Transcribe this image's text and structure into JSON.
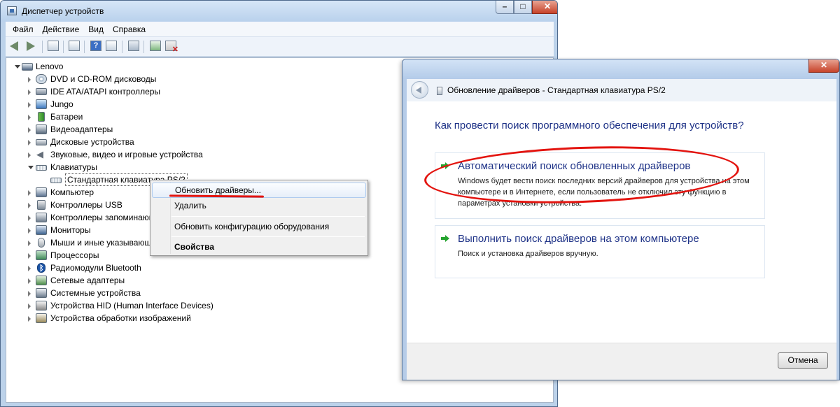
{
  "device_manager": {
    "title": "Диспетчер устройств",
    "menu": [
      "Файл",
      "Действие",
      "Вид",
      "Справка"
    ],
    "tree_root": "Lenovo",
    "tree_items": [
      {
        "label": "DVD и CD-ROM дисководы",
        "icon": "dvd-drive-icon"
      },
      {
        "label": "IDE ATA/ATAPI контроллеры",
        "icon": "ide-controller-icon"
      },
      {
        "label": "Jungo",
        "icon": "jungo-device-icon"
      },
      {
        "label": "Батареи",
        "icon": "battery-icon"
      },
      {
        "label": "Видеоадаптеры",
        "icon": "video-adapter-icon"
      },
      {
        "label": "Дисковые устройства",
        "icon": "disk-drive-icon"
      },
      {
        "label": "Звуковые, видео и игровые устройства",
        "icon": "speaker-icon"
      },
      {
        "label": "Клавиатуры",
        "icon": "keyboard-icon"
      },
      {
        "label": "Стандартная клавиатура PS/2",
        "icon": "keyboard-icon"
      },
      {
        "label": "Компьютер",
        "icon": "computer-icon"
      },
      {
        "label": "Контроллеры USB",
        "icon": "usb-icon"
      },
      {
        "label": "Контроллеры запоминающих устройств",
        "icon": "storage-controller-icon"
      },
      {
        "label": "Мониторы",
        "icon": "monitor-icon"
      },
      {
        "label": "Мыши и иные указывающие устройства",
        "icon": "mouse-icon"
      },
      {
        "label": "Процессоры",
        "icon": "processor-icon"
      },
      {
        "label": "Радиомодули Bluetooth",
        "icon": "bluetooth-icon"
      },
      {
        "label": "Сетевые адаптеры",
        "icon": "network-adapter-icon"
      },
      {
        "label": "Системные устройства",
        "icon": "system-device-icon"
      },
      {
        "label": "Устройства HID (Human Interface Devices)",
        "icon": "hid-icon"
      },
      {
        "label": "Устройства обработки изображений",
        "icon": "imaging-device-icon"
      }
    ],
    "context_menu": {
      "update_drivers": "Обновить драйверы...",
      "delete": "Удалить",
      "scan_hardware": "Обновить конфигурацию оборудования",
      "properties": "Свойства"
    }
  },
  "update_dialog": {
    "title": "Обновление драйверов - Стандартная клавиатура PS/2",
    "question": "Как провести поиск программного обеспечения для устройств?",
    "option_auto": {
      "title": "Автоматический поиск обновленных драйверов",
      "description": "Windows будет вести поиск последних версий драйверов для устройства на этом компьютере и в Интернете, если пользователь не отключил эту функцию в параметрах установки устройства."
    },
    "option_manual": {
      "title": "Выполнить поиск драйверов на этом компьютере",
      "description": "Поиск и установка драйверов вручную."
    },
    "cancel": "Отмена"
  },
  "colors": {
    "annotation": "#e3140f",
    "link_blue": "#1e3287",
    "window_frame": "#bcd2ea"
  }
}
